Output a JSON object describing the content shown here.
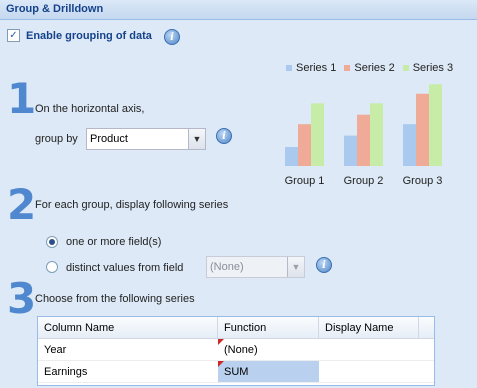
{
  "panel": {
    "title": "Group & Drilldown"
  },
  "enable": {
    "checked": true,
    "check_glyph": "✓",
    "label": "Enable grouping of data"
  },
  "info_glyph": "i",
  "step1": {
    "number": "1",
    "text": "On the horizontal axis,",
    "group_by_label": "group by",
    "group_by_value": "Product"
  },
  "step2": {
    "number": "2",
    "text": "For each group, display following series",
    "options": [
      {
        "label": "one or more field(s)",
        "selected": true
      },
      {
        "label": "distinct values from field",
        "selected": false
      }
    ],
    "distinct_field_value": "(None)"
  },
  "step3": {
    "number": "3",
    "text": "Choose from the following series"
  },
  "grid": {
    "columns": [
      "Column Name",
      "Function",
      "Display Name"
    ],
    "rows": [
      {
        "column": "Year",
        "function": "(None)",
        "display": ""
      },
      {
        "column": "Earnings",
        "function": "SUM",
        "display": ""
      }
    ]
  },
  "preview_chart": {
    "legend": [
      "Series 1",
      "Series 2",
      "Series 3"
    ],
    "categories": [
      "Group 1",
      "Group 2",
      "Group 3"
    ],
    "colors": [
      "#a9c9ee",
      "#f0aa98",
      "#c7eca8"
    ],
    "values": [
      [
        1,
        2.2,
        3.3
      ],
      [
        1.6,
        2.7,
        3.3
      ],
      [
        2.2,
        3.8,
        4.3
      ]
    ]
  }
}
